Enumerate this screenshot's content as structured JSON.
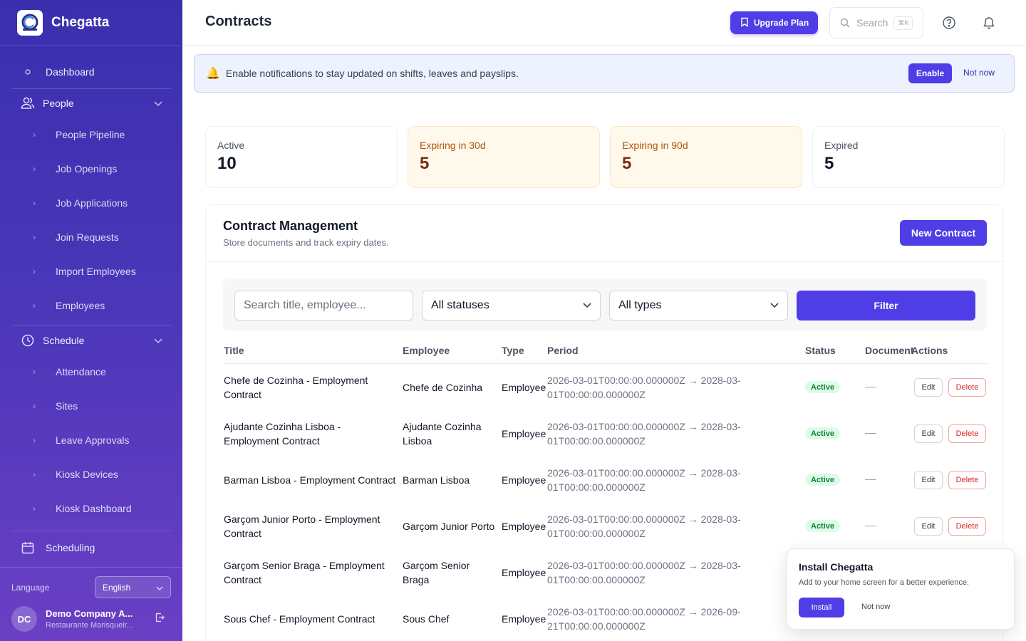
{
  "brand": {
    "name": "Chegatta"
  },
  "sidebar": {
    "dashboard": "Dashboard",
    "people": {
      "label": "People",
      "items": [
        "People Pipeline",
        "Job Openings",
        "Job Applications",
        "Join Requests",
        "Import Employees",
        "Employees"
      ]
    },
    "schedule": {
      "label": "Schedule",
      "items": [
        "Attendance",
        "Sites",
        "Leave Approvals",
        "Kiosk Devices",
        "Kiosk Dashboard"
      ]
    },
    "scheduling": "Scheduling",
    "language_label": "Language",
    "language_value": "English",
    "user": {
      "initials": "DC",
      "name": "Demo Company A...",
      "org": "Restaurante Marisqueir..."
    }
  },
  "topbar": {
    "title": "Contracts",
    "upgrade": "Upgrade Plan",
    "search": "Search",
    "search_shortcut": "⌘K"
  },
  "banner": {
    "icon": "🔔",
    "text": "Enable notifications to stay updated on shifts, leaves and payslips.",
    "enable": "Enable",
    "not_now": "Not now"
  },
  "stats": [
    {
      "label": "Active",
      "value": "10"
    },
    {
      "label": "Expiring in 30d",
      "value": "5"
    },
    {
      "label": "Expiring in 90d",
      "value": "5"
    },
    {
      "label": "Expired",
      "value": "5"
    }
  ],
  "panel": {
    "title": "Contract Management",
    "subtitle": "Store documents and track expiry dates.",
    "new_button": "New Contract"
  },
  "filters": {
    "search_placeholder": "Search title, employee...",
    "status": "All statuses",
    "type": "All types",
    "filter_button": "Filter"
  },
  "table": {
    "headers": [
      "Title",
      "Employee",
      "Type",
      "Period",
      "Status",
      "Document",
      "Actions"
    ],
    "rows": [
      {
        "title": "Chefe de Cozinha - Employment Contract",
        "employee": "Chefe de Cozinha",
        "type": "Employee",
        "period": "2026-03-01T00:00:00.000000Z → 2028-03-01T00:00:00.000000Z",
        "status": "Active",
        "document": "—"
      },
      {
        "title": "Ajudante Cozinha Lisboa - Employment Contract",
        "employee": "Ajudante Cozinha Lisboa",
        "type": "Employee",
        "period": "2026-03-01T00:00:00.000000Z → 2028-03-01T00:00:00.000000Z",
        "status": "Active",
        "document": "—"
      },
      {
        "title": "Barman Lisboa - Employment Contract",
        "employee": "Barman Lisboa",
        "type": "Employee",
        "period": "2026-03-01T00:00:00.000000Z → 2028-03-01T00:00:00.000000Z",
        "status": "Active",
        "document": "—"
      },
      {
        "title": "Garçom Junior Porto - Employment Contract",
        "employee": "Garçom Junior Porto",
        "type": "Employee",
        "period": "2026-03-01T00:00:00.000000Z → 2028-03-01T00:00:00.000000Z",
        "status": "Active",
        "document": "—"
      },
      {
        "title": "Garçom Senior Braga - Employment Contract",
        "employee": "Garçom Senior Braga",
        "type": "Employee",
        "period": "2026-03-01T00:00:00.000000Z → 2028-03-01T00:00:00.000000Z",
        "status": "",
        "document": ""
      },
      {
        "title": "Sous Chef - Employment Contract",
        "employee": "Sous Chef",
        "type": "Employee",
        "period": "2026-03-01T00:00:00.000000Z → 2026-09-21T00:00:00.000000Z",
        "status": "",
        "document": ""
      }
    ],
    "edit": "Edit",
    "delete": "Delete"
  },
  "install": {
    "title": "Install Chegatta",
    "subtitle": "Add to your home screen for a better experience.",
    "install": "Install",
    "not_now": "Not now"
  },
  "colors": {
    "accent": "#4f3ee6",
    "sidebar": "#3b2fae",
    "active_pill": "#dcfce7",
    "warn_card": "#fff9ec"
  }
}
